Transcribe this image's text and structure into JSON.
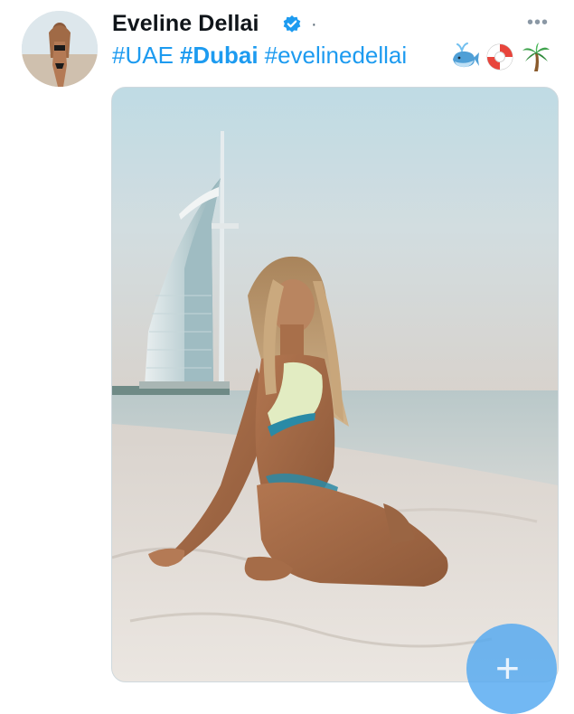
{
  "tweet": {
    "author_name": "Eveline Dellai",
    "separator": "·",
    "more_label": "•••",
    "hashtags": [
      "#UAE",
      "#Dubai",
      "#evelinedellai"
    ],
    "emojis": [
      "whale-icon",
      "life-ring-icon",
      "palm-tree-icon"
    ],
    "accent_color": "#1d9bf0"
  },
  "media": {
    "plus_label": "+"
  }
}
